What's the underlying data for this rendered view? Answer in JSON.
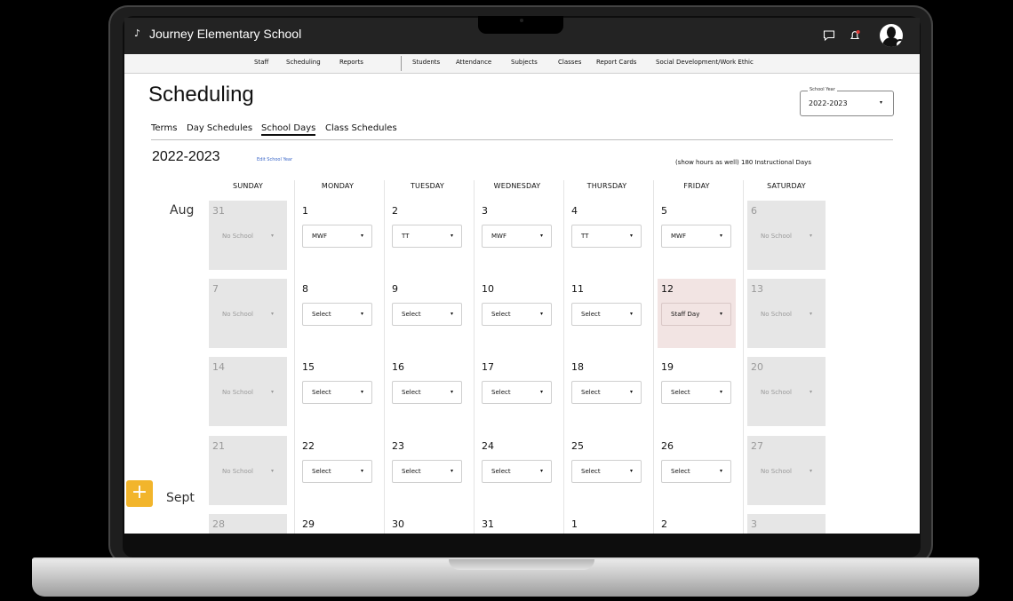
{
  "app": {
    "logo_glyph": "♪",
    "title": "Journey Elementary School"
  },
  "header_icons": [
    "chat-icon",
    "bell-icon",
    "user-avatar"
  ],
  "nav": [
    "Staff",
    "Scheduling",
    "Reports",
    "Students",
    "Attendance",
    "Subjects",
    "Classes",
    "Report Cards",
    "Social Development/Work Ethic"
  ],
  "page": {
    "title": "Scheduling"
  },
  "tabs": [
    "Terms",
    "Day Schedules",
    "School Days",
    "Class Schedules"
  ],
  "active_tab": "School Days",
  "school_year": {
    "label": "School Year",
    "value": "2022-2023",
    "caret": "▾"
  },
  "year_heading": "2022-2023",
  "edit_link": "Edit School Year",
  "instructional": "(show hours as well) 180 Instructional Days",
  "days": [
    "SUNDAY",
    "MONDAY",
    "TUESDAY",
    "WEDNESDAY",
    "THURSDAY",
    "FRIDAY",
    "SATURDAY"
  ],
  "months": [
    "Aug",
    "Sept"
  ],
  "weeks": [
    [
      {
        "day": "31",
        "value": "No School",
        "type": "off"
      },
      {
        "day": "1",
        "value": "MWF",
        "type": "normal"
      },
      {
        "day": "2",
        "value": "TT",
        "type": "normal"
      },
      {
        "day": "3",
        "value": "MWF",
        "type": "normal"
      },
      {
        "day": "4",
        "value": "TT",
        "type": "normal"
      },
      {
        "day": "5",
        "value": "MWF",
        "type": "normal"
      },
      {
        "day": "6",
        "value": "No School",
        "type": "off"
      }
    ],
    [
      {
        "day": "7",
        "value": "No School",
        "type": "off"
      },
      {
        "day": "8",
        "value": "Select",
        "type": "normal"
      },
      {
        "day": "9",
        "value": "Select",
        "type": "normal"
      },
      {
        "day": "10",
        "value": "Select",
        "type": "normal"
      },
      {
        "day": "11",
        "value": "Select",
        "type": "normal"
      },
      {
        "day": "12",
        "value": "Staff Day",
        "type": "staff"
      },
      {
        "day": "13",
        "value": "No School",
        "type": "off"
      }
    ],
    [
      {
        "day": "14",
        "value": "No School",
        "type": "off"
      },
      {
        "day": "15",
        "value": "Select",
        "type": "normal"
      },
      {
        "day": "16",
        "value": "Select",
        "type": "normal"
      },
      {
        "day": "17",
        "value": "Select",
        "type": "normal"
      },
      {
        "day": "18",
        "value": "Select",
        "type": "normal"
      },
      {
        "day": "19",
        "value": "Select",
        "type": "normal"
      },
      {
        "day": "20",
        "value": "No School",
        "type": "off"
      }
    ],
    [
      {
        "day": "21",
        "value": "No School",
        "type": "off"
      },
      {
        "day": "22",
        "value": "Select",
        "type": "normal"
      },
      {
        "day": "23",
        "value": "Select",
        "type": "normal"
      },
      {
        "day": "24",
        "value": "Select",
        "type": "normal"
      },
      {
        "day": "25",
        "value": "Select",
        "type": "normal"
      },
      {
        "day": "26",
        "value": "Select",
        "type": "normal"
      },
      {
        "day": "27",
        "value": "No School",
        "type": "off"
      }
    ],
    [
      {
        "day": "28",
        "value": "",
        "type": "off"
      },
      {
        "day": "29",
        "value": "",
        "type": "normal"
      },
      {
        "day": "30",
        "value": "",
        "type": "normal"
      },
      {
        "day": "31",
        "value": "",
        "type": "normal"
      },
      {
        "day": "1",
        "value": "",
        "type": "normal"
      },
      {
        "day": "2",
        "value": "",
        "type": "normal"
      },
      {
        "day": "3",
        "value": "",
        "type": "off"
      }
    ]
  ],
  "fab_label": "+",
  "select_caret": "▾",
  "colors": {
    "header": "#232323",
    "off_day": "#e6e6e6",
    "staff_day": "#f2e4e3",
    "fab": "#f2b52c",
    "link": "#3a66c8"
  }
}
